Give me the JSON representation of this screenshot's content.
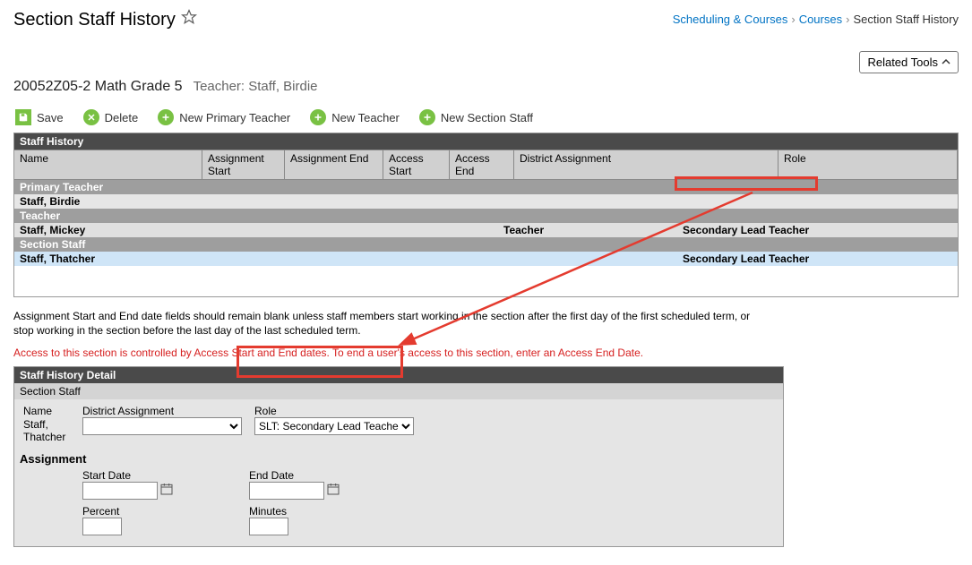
{
  "header": {
    "title": "Section Staff History",
    "breadcrumb": [
      {
        "label": "Scheduling & Courses",
        "link": true
      },
      {
        "label": "Courses",
        "link": true
      },
      {
        "label": "Section Staff History",
        "link": false
      }
    ],
    "related_tools_label": "Related Tools"
  },
  "subtitle": {
    "course": "20052Z05-2 Math Grade 5",
    "teacher_label": "Teacher: Staff, Birdie"
  },
  "toolbar": {
    "save": "Save",
    "delete": "Delete",
    "new_primary": "New Primary Teacher",
    "new_teacher": "New Teacher",
    "new_section_staff": "New Section Staff"
  },
  "grid": {
    "title": "Staff History",
    "columns": {
      "name": "Name",
      "a_start": "Assignment Start",
      "a_end": "Assignment End",
      "acc_start": "Access Start",
      "acc_end": "Access End",
      "district": "District Assignment",
      "role": "Role"
    },
    "sections": {
      "primary": "Primary Teacher",
      "teacher": "Teacher",
      "section_staff": "Section Staff"
    },
    "rows": {
      "primary": {
        "name": "Staff, Birdie",
        "district": "",
        "role": ""
      },
      "teacher": {
        "name": "Staff, Mickey",
        "district": "Teacher",
        "role": "Secondary Lead Teacher"
      },
      "section_staff": {
        "name": "Staff, Thatcher",
        "district": "",
        "role": "Secondary Lead Teacher"
      }
    }
  },
  "help": {
    "line1": "Assignment Start and End date fields should remain blank unless staff members start working in the section after the first day of the first scheduled term, or stop working in the section before the last day of the last scheduled term.",
    "line2": "Access to this section is controlled by Access Start and End dates. To end a user's access to this section, enter an Access End Date."
  },
  "detail": {
    "panel_title": "Staff History Detail",
    "panel_sub": "Section Staff",
    "labels": {
      "name": "Name",
      "district": "District Assignment",
      "role": "Role",
      "assignment": "Assignment",
      "start_date": "Start Date",
      "end_date": "End Date",
      "percent": "Percent",
      "minutes": "Minutes"
    },
    "values": {
      "name": "Staff, Thatcher",
      "district_selected": "",
      "role_selected": "SLT: Secondary Lead Teacher",
      "start_date": "",
      "end_date": "",
      "percent": "",
      "minutes": ""
    }
  }
}
